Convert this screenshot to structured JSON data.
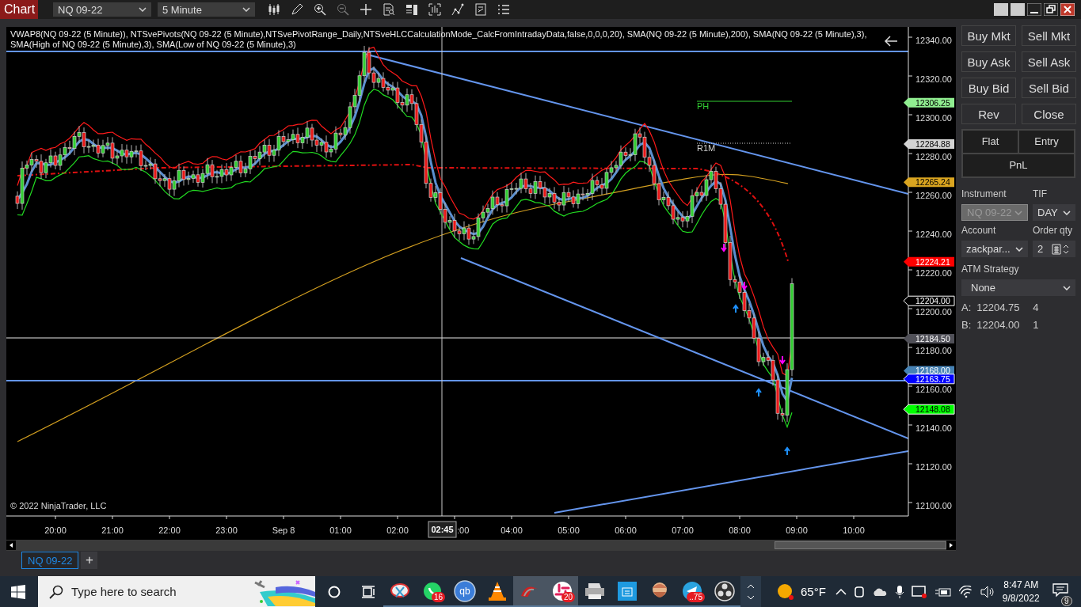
{
  "topbar": {
    "tab": "Chart",
    "instrument": "NQ 09-22",
    "interval": "5 Minute"
  },
  "chart": {
    "legend": "VWAP8(NQ 09-22 (5 Minute)), NTSvePivots(NQ 09-22 (5 Minute),NTSvePivotRange_Daily,NTSveHLCCalculationMode_CalcFromIntradayData,false,0,0,0,20), SMA(NQ 09-22 (5 Minute),200), SMA(NQ 09-22 (5 Minute),3), SMA(High of NQ 09-22 (5 Minute),3), SMA(Low of NQ 09-22 (5 Minute),3)",
    "copyright": "© 2022 NinjaTrader, LLC",
    "pivot_labels": [
      {
        "label": "PH",
        "color": "#32cd32"
      },
      {
        "label": "R1M",
        "color": "#d3d3d3"
      }
    ],
    "price_ticks": [
      "12340.00",
      "12320.00",
      "12300.00",
      "12280.00",
      "12260.00",
      "12240.00",
      "12220.00",
      "12200.00",
      "12180.00",
      "12160.00",
      "12140.00",
      "12120.00",
      "12100.00"
    ],
    "price_tags": [
      {
        "price": "12306.25",
        "color": "#90ee90"
      },
      {
        "price": "12284.88",
        "color": "#d3d3d3"
      },
      {
        "price": "12265.24",
        "color": "#daa520"
      },
      {
        "price": "12224.21",
        "color": "#ff0000"
      },
      {
        "price": "12204.00",
        "color": "#000000"
      },
      {
        "price": "12184.50",
        "color": "#505058"
      },
      {
        "price": "12168.00",
        "color": "#4682b4"
      },
      {
        "price": "12163.75",
        "color": "#0000ff"
      },
      {
        "price": "12148.08",
        "color": "#00ff00"
      }
    ],
    "time_labels": [
      {
        "label": "20:00",
        "kind": "full"
      },
      {
        "label": "21:00",
        "kind": "full"
      },
      {
        "label": "22:00",
        "kind": "full"
      },
      {
        "label": "23:00",
        "kind": "full"
      },
      {
        "label": "Sep 8",
        "kind": "full"
      },
      {
        "label": "01:00",
        "kind": "full"
      },
      {
        "label": "02:00",
        "kind": "full"
      },
      {
        "label": ":00",
        "kind": "clipped"
      },
      {
        "label": "04:00",
        "kind": "full"
      },
      {
        "label": "05:00",
        "kind": "full"
      },
      {
        "label": "06:00",
        "kind": "full"
      },
      {
        "label": "07:00",
        "kind": "full"
      },
      {
        "label": "08:00",
        "kind": "full"
      },
      {
        "label": "09:00",
        "kind": "full"
      },
      {
        "label": "10:00",
        "kind": "full"
      }
    ],
    "crosshair_time": "02:45"
  },
  "order_panel": {
    "buttons": [
      "Buy Mkt",
      "Sell Mkt",
      "Buy Ask",
      "Sell Ask",
      "Buy Bid",
      "Sell Bid",
      "Rev",
      "Close"
    ],
    "position": [
      "Flat",
      "Entry",
      "PnL"
    ],
    "fields": [
      {
        "label": "Instrument",
        "value": "NQ 09-22",
        "disabled": true,
        "kind": "select"
      },
      {
        "label": "TIF",
        "value": "DAY",
        "disabled": false,
        "kind": "select"
      },
      {
        "label": "Account",
        "value": "zackpar...",
        "disabled": false,
        "kind": "select"
      },
      {
        "label": "Order qty",
        "value": "2",
        "disabled": false,
        "kind": "spinner"
      }
    ],
    "atm": {
      "label": "ATM Strategy",
      "value": "None"
    },
    "quotes": [
      {
        "side": "A:",
        "price": "12204.75",
        "size": "4"
      },
      {
        "side": "B:",
        "price": "12204.00",
        "size": "1"
      }
    ]
  },
  "tabs": [
    {
      "label": "NQ 09-22",
      "selected": true
    }
  ],
  "add_tab": "+",
  "taskbar": {
    "search_placeholder": "Type here to search",
    "apps": [
      {
        "kind": "snip",
        "active": false
      },
      {
        "kind": "chat",
        "badge": "16",
        "active": false
      },
      {
        "kind": "qb",
        "active": false,
        "label": "qb"
      },
      {
        "kind": "cone",
        "active": false
      },
      {
        "kind": "swoosh",
        "active": true
      },
      {
        "kind": "slack",
        "badge": "20",
        "active": true
      },
      {
        "kind": "printer",
        "active": false
      },
      {
        "kind": "store",
        "active": false
      },
      {
        "kind": "avatar",
        "active": false
      },
      {
        "kind": "plane",
        "badge": "..75",
        "active": false
      },
      {
        "kind": "obs",
        "active": false
      }
    ],
    "temperature": "65°F",
    "time": "8:47 AM",
    "date": "9/8/2022",
    "notifications": "9"
  }
}
